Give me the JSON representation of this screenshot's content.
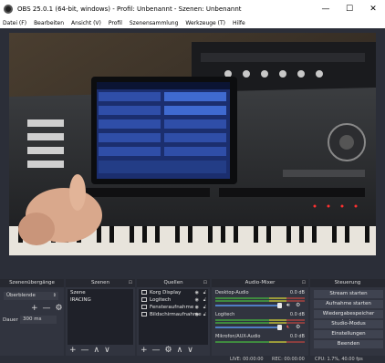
{
  "window": {
    "title": "OBS 25.0.1 (64-bit, windows) - Profil: Unbenannt - Szenen: Unbenannt",
    "minimize": "—",
    "maximize": "☐",
    "close": "✕"
  },
  "menu": {
    "items": [
      "Datei (F)",
      "Bearbeiten",
      "Ansicht (V)",
      "Profil",
      "Szenensammlung",
      "Werkzeuge (T)",
      "Hilfe"
    ]
  },
  "panels": {
    "transitions": {
      "title": "Szenenübergänge",
      "selected": "Überblende",
      "duration_label": "Dauer",
      "duration_value": "300 ms"
    },
    "scenes": {
      "title": "Szenen",
      "items": [
        "Szene",
        "IRACING"
      ]
    },
    "sources": {
      "title": "Quellen",
      "items": [
        "Korg Display",
        "Logitech",
        "Fensteraufnahme",
        "Bildschirmaufnahme"
      ]
    },
    "mixer": {
      "title": "Audio-Mixer",
      "channels": [
        {
          "name": "Desktop-Audio",
          "db": "0.0 dB"
        },
        {
          "name": "Logitech",
          "db": "0.0 dB"
        },
        {
          "name": "Mikrofon/AUX-Audio",
          "db": "0.0 dB"
        }
      ]
    },
    "controls": {
      "title": "Steuerung",
      "buttons": [
        "Stream starten",
        "Aufnahme starten",
        "Wiedergabespeicher starten",
        "Studio-Modus",
        "Einstellungen",
        "Beenden"
      ]
    }
  },
  "toolbar": {
    "add": "+",
    "remove": "—",
    "up": "∧",
    "down": "∨",
    "gear": "⚙"
  },
  "status": {
    "live": "LIVE: 00:00:00",
    "rec": "REC: 00:00:00",
    "cpu": "CPU: 1.7%, 40.00 fps"
  },
  "icons": {
    "app": "obs-logo-icon",
    "eye": "eye-icon",
    "lock": "lock-icon",
    "speaker": "speaker-icon",
    "gear": "gear-icon"
  },
  "colors": {
    "background": "#2b2e38",
    "panel": "#31343f",
    "button": "#3f4350",
    "fader": "#4f7ec4",
    "selection": "#3c4a63"
  }
}
